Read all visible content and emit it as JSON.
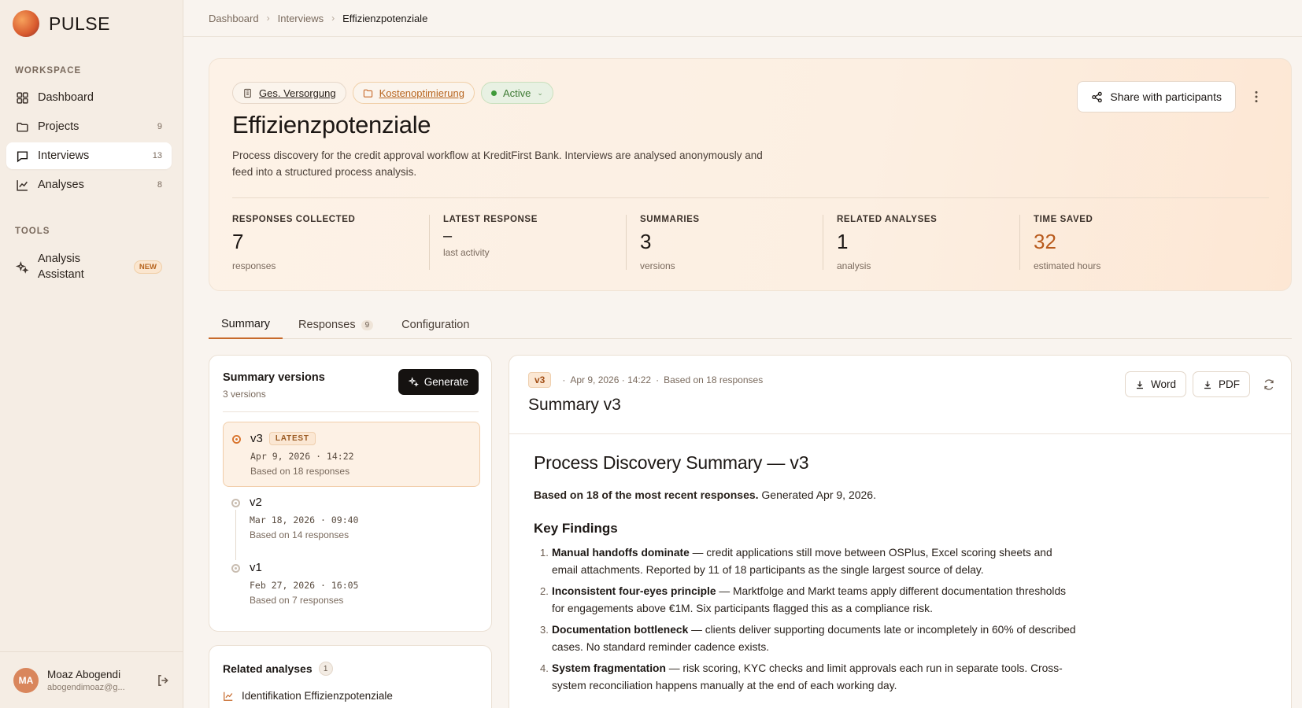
{
  "brand": {
    "name": "PULSE"
  },
  "sidebar": {
    "workspace_title": "WORKSPACE",
    "tools_title": "TOOLS",
    "items": [
      {
        "label": "Dashboard",
        "count": ""
      },
      {
        "label": "Projects",
        "count": "9"
      },
      {
        "label": "Interviews",
        "count": "13"
      },
      {
        "label": "Analyses",
        "count": "8"
      }
    ],
    "tools": [
      {
        "label": "Analysis Assistant",
        "badge": "NEW"
      }
    ],
    "user": {
      "initials": "MA",
      "name": "Moaz Abogendi",
      "email": "abogendimoaz@g..."
    }
  },
  "breadcrumb": [
    "Dashboard",
    "Interviews",
    "Effizienzpotenziale"
  ],
  "hero": {
    "chips": [
      "Ges. Versorgung",
      "Kostenoptimierung"
    ],
    "status": "Active",
    "title": "Effizienzpotenziale",
    "description": "Process discovery for the credit approval workflow at KreditFirst Bank. Interviews are analysed anonymously and feed into a structured process analysis.",
    "share_label": "Share with participants",
    "stats": [
      {
        "label": "RESPONSES COLLECTED",
        "value": "7",
        "sub": "responses"
      },
      {
        "label": "LATEST RESPONSE",
        "value": "–",
        "sub": "last activity"
      },
      {
        "label": "SUMMARIES",
        "value": "3",
        "sub": "versions"
      },
      {
        "label": "RELATED ANALYSES",
        "value": "1",
        "sub": "analysis"
      },
      {
        "label": "TIME SAVED",
        "value": "32",
        "sub": "estimated hours"
      }
    ]
  },
  "tabs": [
    {
      "label": "Summary",
      "count": ""
    },
    {
      "label": "Responses",
      "count": "9"
    },
    {
      "label": "Configuration",
      "count": ""
    }
  ],
  "versions_panel": {
    "title": "Summary versions",
    "subtitle": "3 versions",
    "generate_label": "Generate",
    "latest_label": "LATEST",
    "versions": [
      {
        "name": "v3",
        "date": "Apr 9, 2026 · 14:22",
        "based": "Based on 18 responses"
      },
      {
        "name": "v2",
        "date": "Mar 18, 2026 · 09:40",
        "based": "Based on 14 responses"
      },
      {
        "name": "v1",
        "date": "Feb 27, 2026 · 16:05",
        "based": "Based on 7 responses"
      }
    ]
  },
  "related": {
    "title": "Related analyses",
    "count": "1",
    "items": [
      "Identifikation Effizienzpotenziale"
    ]
  },
  "doc": {
    "version_tag": "v3",
    "date": "Apr 9, 2026 · 14:22",
    "based": "Based on 18 responses",
    "title": "Summary v3",
    "word_label": "Word",
    "pdf_label": "PDF",
    "h1": "Process Discovery Summary — v3",
    "lead_bold": "Based on 18 of the most recent responses.",
    "lead_rest": " Generated Apr 9, 2026.",
    "h2": "Key Findings",
    "findings": [
      {
        "num": "1.",
        "bold": "Manual handoffs dominate",
        "text": " — credit applications still move between OSPlus, Excel scoring sheets and email attachments. Reported by 11 of 18 participants as the single largest source of delay."
      },
      {
        "num": "2.",
        "bold": "Inconsistent four-eyes principle",
        "text": " — Marktfolge and Markt teams apply different documentation thresholds for engagements above €1M. Six participants flagged this as a compliance risk."
      },
      {
        "num": "3.",
        "bold": "Documentation bottleneck",
        "text": " — clients deliver supporting documents late or incompletely in 60% of described cases. No standard reminder cadence exists."
      },
      {
        "num": "4.",
        "bold": "System fragmentation",
        "text": " — risk scoring, KYC checks and limit approvals each run in separate tools. Cross-system reconciliation happens manually at the end of each working day."
      }
    ]
  },
  "colors": {
    "accent": "#c76a2b",
    "status_green": "#3f7b35",
    "time_saved": "#b85a1c"
  }
}
